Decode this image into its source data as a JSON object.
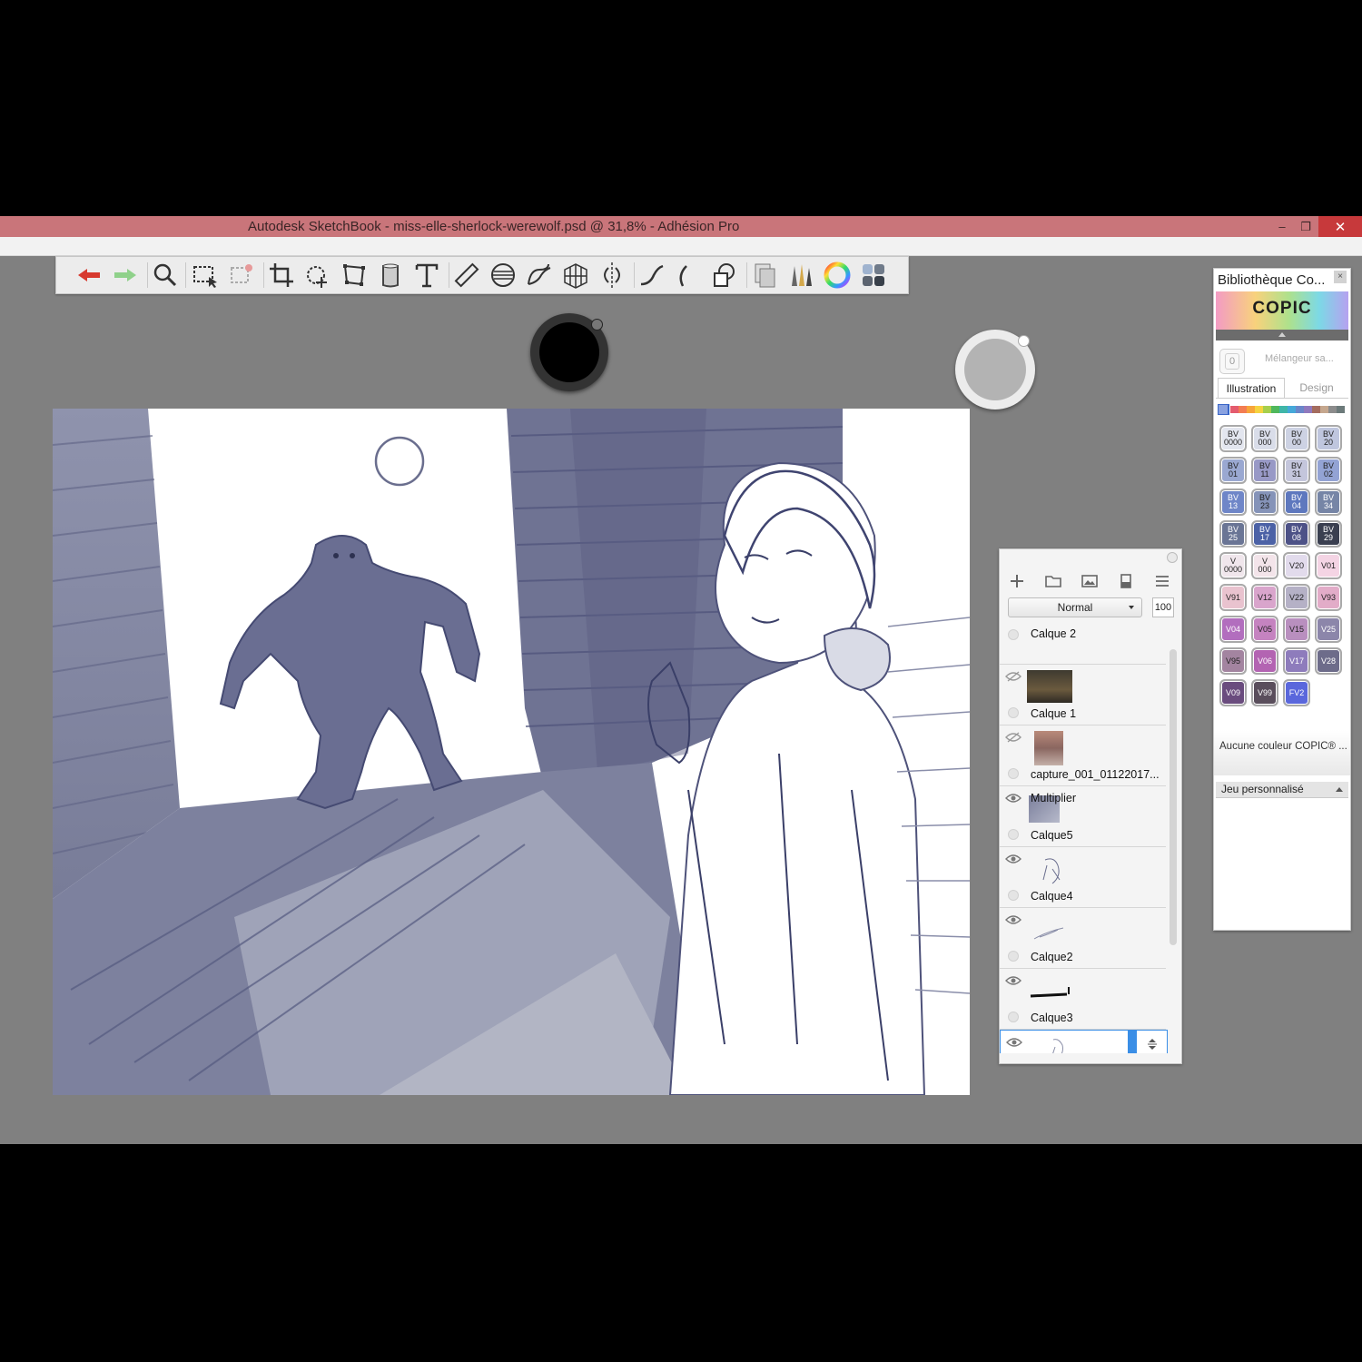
{
  "window": {
    "title": "Autodesk SketchBook - miss-elle-sherlock-werewolf.psd @ 31,8% - Adhésion Pro",
    "minimize_glyph": "‒",
    "restore_glyph": "❐",
    "close_glyph": "✕"
  },
  "toolbar": {
    "tools": [
      "undo-icon",
      "redo-icon",
      "zoom-icon",
      "selection-icon",
      "transform-selection-icon",
      "crop-icon",
      "move-rotate-icon",
      "distort-icon",
      "fill-icon",
      "text-icon",
      "ruler-icon",
      "ellipse-guide-icon",
      "french-curve-icon",
      "perspective-icon",
      "symmetry-icon",
      "stroke-icon",
      "line-icon",
      "shapes-icon",
      "copy-paste-icon",
      "brush-library-icon",
      "color-wheel-icon",
      "copic-library-icon"
    ]
  },
  "pucks": {
    "brush_color": "#000000",
    "grey_color": "#b3b3b3"
  },
  "layers": {
    "blend_mode": "Normal",
    "opacity": "100",
    "items": [
      {
        "name": "Calque 2",
        "visible": true,
        "mode": ""
      },
      {
        "name": "Calque 1",
        "visible": false,
        "mode": ""
      },
      {
        "name": "capture_001_01122017...",
        "visible": false,
        "mode": ""
      },
      {
        "name": "Calque5",
        "visible": true,
        "mode": "Multiplier"
      },
      {
        "name": "Calque4",
        "visible": true,
        "mode": ""
      },
      {
        "name": "Calque2",
        "visible": true,
        "mode": ""
      },
      {
        "name": "Calque3",
        "visible": true,
        "mode": ""
      },
      {
        "name": "",
        "visible": true,
        "mode": ""
      }
    ]
  },
  "copic": {
    "title": "Bibliothèque Co...",
    "close": "×",
    "logo": "COPIC",
    "mixer_value": "0",
    "mixer_label": "Mélangeur sa...",
    "tabs": [
      "Illustration",
      "Design"
    ],
    "swatches": [
      {
        "label": "BV\n0000",
        "color": "#e3e6ef"
      },
      {
        "label": "BV\n000",
        "color": "#d9dde9"
      },
      {
        "label": "BV\n00",
        "color": "#cdd2e3"
      },
      {
        "label": "BV\n20",
        "color": "#bfc6de"
      },
      {
        "label": "BV\n01",
        "color": "#9aa8d1"
      },
      {
        "label": "BV\n11",
        "color": "#9899c6"
      },
      {
        "label": "BV\n31",
        "color": "#c4c6dc"
      },
      {
        "label": "BV\n02",
        "color": "#93a3d4"
      },
      {
        "label": "BV\n13",
        "color": "#6f86c8"
      },
      {
        "label": "BV\n23",
        "color": "#8593b8"
      },
      {
        "label": "BV\n04",
        "color": "#5e78be"
      },
      {
        "label": "BV\n34",
        "color": "#7685a6"
      },
      {
        "label": "BV\n25",
        "color": "#6a7595"
      },
      {
        "label": "BV\n17",
        "color": "#4c62a6"
      },
      {
        "label": "BV\n08",
        "color": "#4d5287"
      },
      {
        "label": "BV\n29",
        "color": "#3a3f50"
      },
      {
        "label": "V\n0000",
        "color": "#f0e6ec"
      },
      {
        "label": "V\n000",
        "color": "#f3e4ea"
      },
      {
        "label": "V20",
        "color": "#e2dbec"
      },
      {
        "label": "V01",
        "color": "#f4d4e4"
      },
      {
        "label": "V91",
        "color": "#e9c3cf"
      },
      {
        "label": "V12",
        "color": "#d9a5cc"
      },
      {
        "label": "V22",
        "color": "#b5b1c6"
      },
      {
        "label": "V93",
        "color": "#e2acc8"
      },
      {
        "label": "V04",
        "color": "#b26ebe"
      },
      {
        "label": "V05",
        "color": "#c583c0"
      },
      {
        "label": "V15",
        "color": "#b98fbf"
      },
      {
        "label": "V25",
        "color": "#8c86aa"
      },
      {
        "label": "V95",
        "color": "#a384a0"
      },
      {
        "label": "V06",
        "color": "#b364b2"
      },
      {
        "label": "V17",
        "color": "#8e7cbc"
      },
      {
        "label": "V28",
        "color": "#6d6c8a"
      },
      {
        "label": "V09",
        "color": "#6a4c7e"
      },
      {
        "label": "V99",
        "color": "#5a4e5c"
      },
      {
        "label": "FV2",
        "color": "#5a67dc"
      }
    ],
    "no_color": "Aucune couleur COPIC® ...",
    "custom_set": "Jeu personnalisé"
  }
}
